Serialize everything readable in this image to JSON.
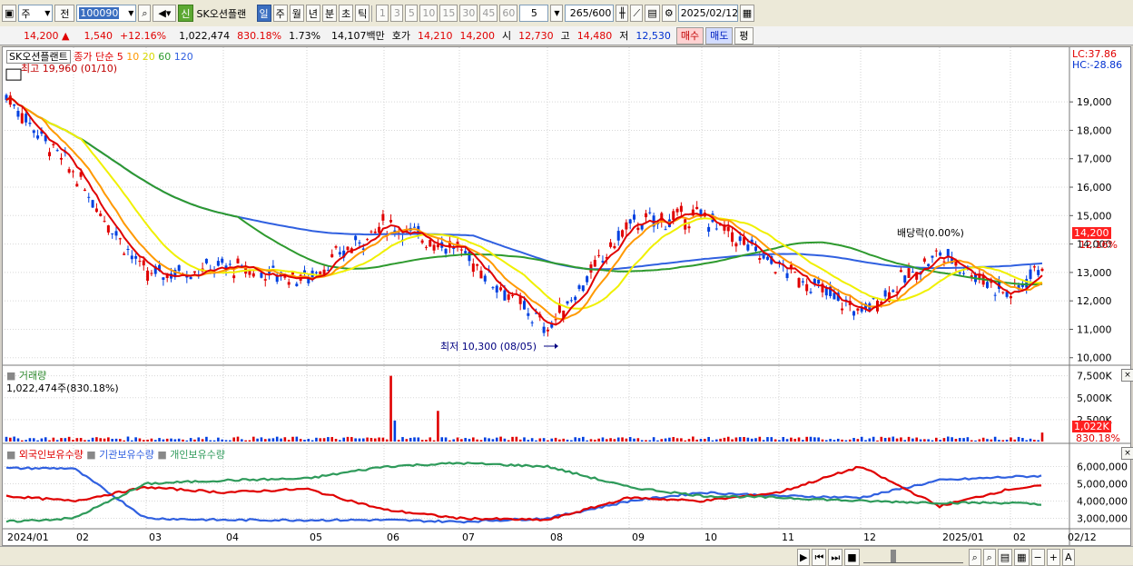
{
  "toolbar": {
    "market_label": "주",
    "prev_label": "전",
    "code_value": "100090",
    "stock_badge": "신",
    "stock_name": "SK오션플랜",
    "period_buttons": [
      {
        "label": "일",
        "selected": true
      },
      {
        "label": "주",
        "selected": false
      },
      {
        "label": "월",
        "selected": false
      },
      {
        "label": "년",
        "selected": false
      },
      {
        "label": "분",
        "selected": false
      },
      {
        "label": "초",
        "selected": false
      },
      {
        "label": "틱",
        "selected": false
      }
    ],
    "intervals": [
      "1",
      "3",
      "5",
      "10",
      "15",
      "30",
      "45",
      "60"
    ],
    "interval_value": "5",
    "count_value": "265",
    "count_total": "/600",
    "date_value": "2025/02/12"
  },
  "quote": {
    "price": "14,200",
    "change": "1,540",
    "change_pct": "+12.16%",
    "volume": "1,022,474",
    "volume_ratio": "830.18%",
    "turnover_pct": "1.73%",
    "amount": "14,107백만",
    "ask_label": "호가",
    "ask1": "14,210",
    "ask2": "14,200",
    "open_label": "시",
    "open": "12,730",
    "high_label": "고",
    "high": "14,480",
    "low_label": "저",
    "low": "12,530",
    "buy_label": "매수",
    "sell_label": "매도",
    "eval_label": "평"
  },
  "legend": {
    "name": "SK오션플랜트",
    "ma_label": "종가 단순",
    "ma5": "5",
    "ma10": "10",
    "ma20": "20",
    "ma60": "60",
    "ma120": "120",
    "high_note": "최고 19,960 (01/10)",
    "low_note": "최저 10,300 (08/05)",
    "dividend_note": "배당락(0.00%)",
    "lc": "LC:37.86",
    "hc": "HC:-28.86",
    "volume_title": "거래량",
    "volume_note": "1,022,474주(830.18%)",
    "holding_1": "외국인보유수량",
    "holding_2": "기관보유수량",
    "holding_3": "개인보유수량"
  },
  "colors": {
    "ma5": "#e00000",
    "ma10": "#ff9900",
    "ma20": "#f0f000",
    "ma60": "#2e9a2e",
    "ma120": "#3060e0",
    "foreign": "#3060e0",
    "institution": "#e00000",
    "individual": "#2e9a5a"
  },
  "chart_data": [
    {
      "type": "candlestick",
      "title": "SK오션플랜트",
      "x_ticks": [
        "2024/01",
        "02",
        "03",
        "04",
        "05",
        "06",
        "07",
        "08",
        "09",
        "10",
        "11",
        "12",
        "2025/01",
        "02",
        "02/12"
      ],
      "y_ticks": [
        "19,000",
        "18,000",
        "17,000",
        "16,000",
        "15,000",
        "14,000",
        "13,000",
        "12,000",
        "11,000",
        "10,000"
      ],
      "ylim": [
        9800,
        19900
      ],
      "last_price_label": "14,200",
      "last_change_label": "12.16%",
      "key_points": [
        {
          "month": "2024/01",
          "close": 19300
        },
        {
          "month": "02",
          "close": 16500
        },
        {
          "month": "03",
          "close": 12900
        },
        {
          "month": "04",
          "close": 13200
        },
        {
          "month": "05",
          "close": 12800
        },
        {
          "month": "06",
          "close": 14700
        },
        {
          "month": "07",
          "close": 13800
        },
        {
          "month": "08",
          "close": 11000
        },
        {
          "month": "09",
          "close": 14700
        },
        {
          "month": "10",
          "close": 15000
        },
        {
          "month": "11",
          "close": 13200
        },
        {
          "month": "12",
          "close": 11600
        },
        {
          "month": "2025/01",
          "close": 13700
        },
        {
          "month": "02",
          "close": 12200
        },
        {
          "month": "02/12",
          "close": 14200
        }
      ]
    },
    {
      "type": "bar",
      "title": "거래량",
      "y_ticks": [
        "7,500K",
        "5,000K",
        "2,500K"
      ],
      "last_value_label": "1,022K",
      "last_ratio_label": "830.18%",
      "spikes": [
        {
          "month": "06",
          "value": 7500
        },
        {
          "month": "06",
          "value": 2400
        },
        {
          "month": "07",
          "value": 3500
        },
        {
          "month": "02/12",
          "value": 1022
        }
      ]
    },
    {
      "type": "line",
      "title": "보유수량",
      "y_ticks": [
        "6,000,000",
        "5,000,000",
        "4,000,000",
        "3,000,000"
      ],
      "series": [
        {
          "name": "외국인보유수량",
          "values": [
            5900000,
            5900000,
            3000000,
            2900000,
            2900000,
            2900000,
            2800000,
            3000000,
            4000000,
            4500000,
            4300000,
            4200000,
            5200000,
            5400000,
            5500000
          ]
        },
        {
          "name": "기관보유수량",
          "values": [
            4300000,
            4000000,
            4800000,
            4500000,
            4700000,
            3500000,
            3000000,
            2900000,
            4200000,
            4000000,
            4500000,
            6000000,
            3700000,
            4700000,
            5000000
          ]
        },
        {
          "name": "개인보유수량",
          "values": [
            2800000,
            3000000,
            5000000,
            5200000,
            5300000,
            6000000,
            6200000,
            6000000,
            4800000,
            4300000,
            4200000,
            4000000,
            3900000,
            3900000,
            3700000
          ]
        }
      ]
    }
  ]
}
